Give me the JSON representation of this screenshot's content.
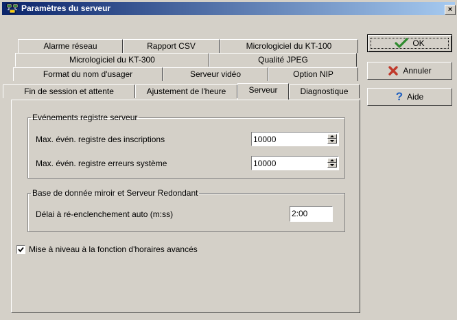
{
  "window": {
    "title": "Paramètres du serveur",
    "close_label": "×"
  },
  "tabs": {
    "row1": [
      "Alarme réseau",
      "Rapport CSV",
      "Micrologiciel du KT-100"
    ],
    "row2": [
      "Micrologiciel du KT-300",
      "Qualité JPEG"
    ],
    "row3": [
      "Format du nom d'usager",
      "Serveur vidéo",
      "Option NIP"
    ],
    "row4": [
      "Fin de session et attente",
      "Ajustement de l'heure",
      "Serveur",
      "Diagnostique"
    ],
    "active": "Serveur"
  },
  "events_group": {
    "legend": "Evénements registre serveur",
    "rows": [
      {
        "label": "Max. évén. registre des inscriptions",
        "value": "10000"
      },
      {
        "label": "Max. évén. registre erreurs système",
        "value": "10000"
      }
    ]
  },
  "mirror_group": {
    "legend": "Base de donnée miroir et Serveur Redondant",
    "delay_label": "Délai à ré-enclenchement auto (m:ss)",
    "delay_value": "2:00"
  },
  "advanced_schedule": {
    "label": "Mise à niveau à la fonction d'horaires avancés",
    "checked": true
  },
  "buttons": {
    "ok": "OK",
    "cancel": "Annuler",
    "help": "Aide"
  },
  "colors": {
    "face": "#d4d0c8",
    "title_start": "#0a246a",
    "title_end": "#a6caf0",
    "ok_check": "#2e8b2e",
    "cancel_x": "#c0392b",
    "help_q": "#1f5fbf"
  }
}
